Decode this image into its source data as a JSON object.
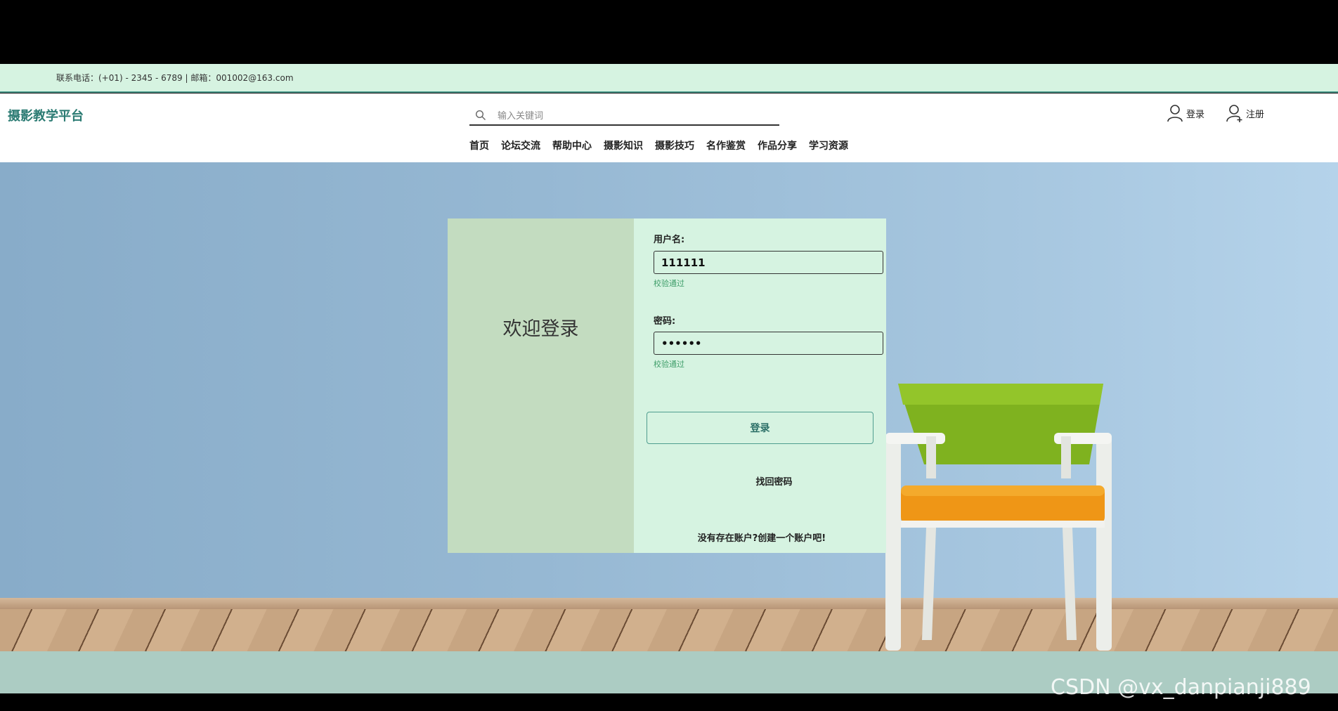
{
  "topbar": {
    "contact": "联系电话：(+01) - 2345 - 6789 | 邮箱：001002@163.com"
  },
  "header": {
    "logo": "摄影教学平台",
    "search_placeholder": "输入关键词",
    "login": "登录",
    "register": "注册"
  },
  "nav": [
    "首页",
    "论坛交流",
    "帮助中心",
    "摄影知识",
    "摄影技巧",
    "名作鉴赏",
    "作品分享",
    "学习资源"
  ],
  "login_form": {
    "welcome": "欢迎登录",
    "username_label": "用户名:",
    "username_value": "111111",
    "username_status": "校验通过",
    "password_label": "密码:",
    "password_value": "••••••",
    "password_status": "校验通过",
    "submit": "登录",
    "forgot": "找回密码",
    "signup": "没有存在账户?创建一个账户吧!"
  },
  "watermark": "CSDN @vx_danpianji889",
  "colors": {
    "accent": "#2b7b73",
    "panel": "#d6f3e1",
    "panel_left": "#c3dcc0",
    "status_ok": "#3f9e6a"
  }
}
